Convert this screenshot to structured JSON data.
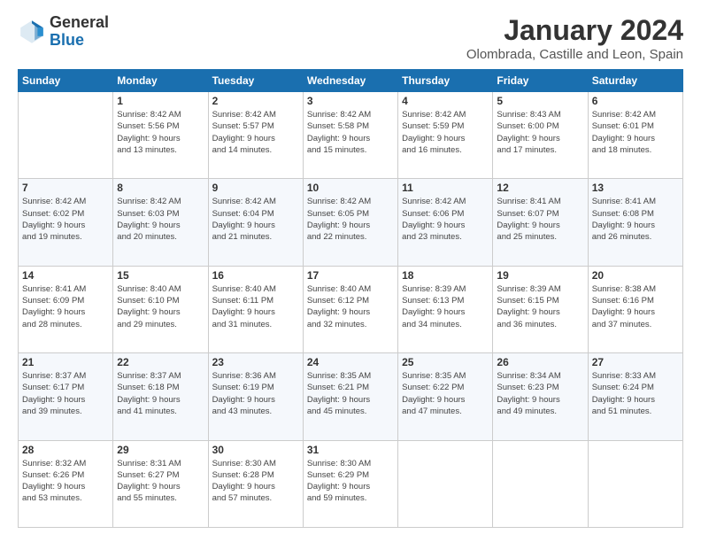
{
  "logo": {
    "general": "General",
    "blue": "Blue"
  },
  "title": "January 2024",
  "subtitle": "Olombrada, Castille and Leon, Spain",
  "headers": [
    "Sunday",
    "Monday",
    "Tuesday",
    "Wednesday",
    "Thursday",
    "Friday",
    "Saturday"
  ],
  "weeks": [
    [
      {
        "day": "",
        "info": ""
      },
      {
        "day": "1",
        "info": "Sunrise: 8:42 AM\nSunset: 5:56 PM\nDaylight: 9 hours\nand 13 minutes."
      },
      {
        "day": "2",
        "info": "Sunrise: 8:42 AM\nSunset: 5:57 PM\nDaylight: 9 hours\nand 14 minutes."
      },
      {
        "day": "3",
        "info": "Sunrise: 8:42 AM\nSunset: 5:58 PM\nDaylight: 9 hours\nand 15 minutes."
      },
      {
        "day": "4",
        "info": "Sunrise: 8:42 AM\nSunset: 5:59 PM\nDaylight: 9 hours\nand 16 minutes."
      },
      {
        "day": "5",
        "info": "Sunrise: 8:43 AM\nSunset: 6:00 PM\nDaylight: 9 hours\nand 17 minutes."
      },
      {
        "day": "6",
        "info": "Sunrise: 8:42 AM\nSunset: 6:01 PM\nDaylight: 9 hours\nand 18 minutes."
      }
    ],
    [
      {
        "day": "7",
        "info": "Sunrise: 8:42 AM\nSunset: 6:02 PM\nDaylight: 9 hours\nand 19 minutes."
      },
      {
        "day": "8",
        "info": "Sunrise: 8:42 AM\nSunset: 6:03 PM\nDaylight: 9 hours\nand 20 minutes."
      },
      {
        "day": "9",
        "info": "Sunrise: 8:42 AM\nSunset: 6:04 PM\nDaylight: 9 hours\nand 21 minutes."
      },
      {
        "day": "10",
        "info": "Sunrise: 8:42 AM\nSunset: 6:05 PM\nDaylight: 9 hours\nand 22 minutes."
      },
      {
        "day": "11",
        "info": "Sunrise: 8:42 AM\nSunset: 6:06 PM\nDaylight: 9 hours\nand 23 minutes."
      },
      {
        "day": "12",
        "info": "Sunrise: 8:41 AM\nSunset: 6:07 PM\nDaylight: 9 hours\nand 25 minutes."
      },
      {
        "day": "13",
        "info": "Sunrise: 8:41 AM\nSunset: 6:08 PM\nDaylight: 9 hours\nand 26 minutes."
      }
    ],
    [
      {
        "day": "14",
        "info": "Sunrise: 8:41 AM\nSunset: 6:09 PM\nDaylight: 9 hours\nand 28 minutes."
      },
      {
        "day": "15",
        "info": "Sunrise: 8:40 AM\nSunset: 6:10 PM\nDaylight: 9 hours\nand 29 minutes."
      },
      {
        "day": "16",
        "info": "Sunrise: 8:40 AM\nSunset: 6:11 PM\nDaylight: 9 hours\nand 31 minutes."
      },
      {
        "day": "17",
        "info": "Sunrise: 8:40 AM\nSunset: 6:12 PM\nDaylight: 9 hours\nand 32 minutes."
      },
      {
        "day": "18",
        "info": "Sunrise: 8:39 AM\nSunset: 6:13 PM\nDaylight: 9 hours\nand 34 minutes."
      },
      {
        "day": "19",
        "info": "Sunrise: 8:39 AM\nSunset: 6:15 PM\nDaylight: 9 hours\nand 36 minutes."
      },
      {
        "day": "20",
        "info": "Sunrise: 8:38 AM\nSunset: 6:16 PM\nDaylight: 9 hours\nand 37 minutes."
      }
    ],
    [
      {
        "day": "21",
        "info": "Sunrise: 8:37 AM\nSunset: 6:17 PM\nDaylight: 9 hours\nand 39 minutes."
      },
      {
        "day": "22",
        "info": "Sunrise: 8:37 AM\nSunset: 6:18 PM\nDaylight: 9 hours\nand 41 minutes."
      },
      {
        "day": "23",
        "info": "Sunrise: 8:36 AM\nSunset: 6:19 PM\nDaylight: 9 hours\nand 43 minutes."
      },
      {
        "day": "24",
        "info": "Sunrise: 8:35 AM\nSunset: 6:21 PM\nDaylight: 9 hours\nand 45 minutes."
      },
      {
        "day": "25",
        "info": "Sunrise: 8:35 AM\nSunset: 6:22 PM\nDaylight: 9 hours\nand 47 minutes."
      },
      {
        "day": "26",
        "info": "Sunrise: 8:34 AM\nSunset: 6:23 PM\nDaylight: 9 hours\nand 49 minutes."
      },
      {
        "day": "27",
        "info": "Sunrise: 8:33 AM\nSunset: 6:24 PM\nDaylight: 9 hours\nand 51 minutes."
      }
    ],
    [
      {
        "day": "28",
        "info": "Sunrise: 8:32 AM\nSunset: 6:26 PM\nDaylight: 9 hours\nand 53 minutes."
      },
      {
        "day": "29",
        "info": "Sunrise: 8:31 AM\nSunset: 6:27 PM\nDaylight: 9 hours\nand 55 minutes."
      },
      {
        "day": "30",
        "info": "Sunrise: 8:30 AM\nSunset: 6:28 PM\nDaylight: 9 hours\nand 57 minutes."
      },
      {
        "day": "31",
        "info": "Sunrise: 8:30 AM\nSunset: 6:29 PM\nDaylight: 9 hours\nand 59 minutes."
      },
      {
        "day": "",
        "info": ""
      },
      {
        "day": "",
        "info": ""
      },
      {
        "day": "",
        "info": ""
      }
    ]
  ]
}
